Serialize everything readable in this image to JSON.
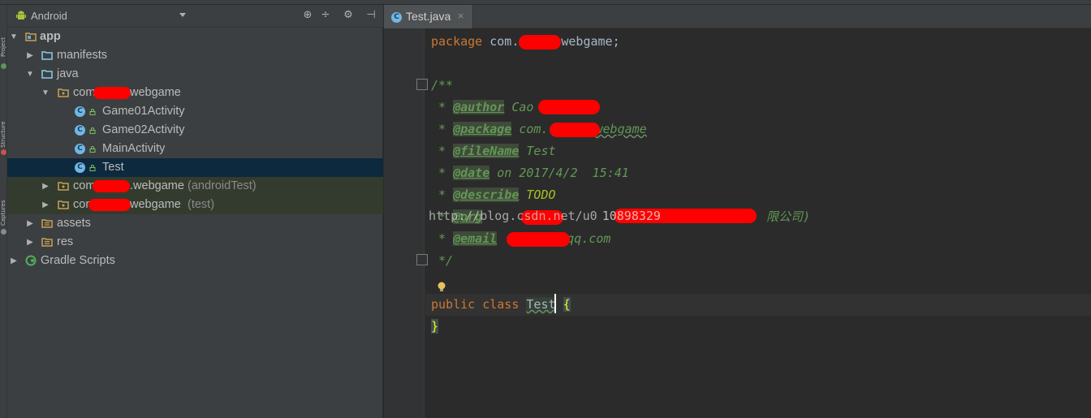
{
  "toolstrip": {
    "labels": [
      "Project",
      "Structure",
      "Captures"
    ],
    "dot_colors": [
      "#57965c",
      "#c75450",
      "#8a8a8a"
    ]
  },
  "project_panel": {
    "view_selector": "Android",
    "header_icons": [
      "target-icon",
      "collapse-icon",
      "gear-icon",
      "pin-icon"
    ],
    "tree": [
      {
        "label": "app",
        "icon": "module-folder-icon",
        "expanded": true
      },
      {
        "label": "manifests",
        "icon": "folder-icon",
        "expanded": false
      },
      {
        "label": "java",
        "icon": "folder-icon",
        "expanded": true
      },
      {
        "prefix": "com",
        "suffix": "webgame",
        "icon": "package-icon",
        "expanded": true
      },
      {
        "label": "Game01Activity",
        "icon": "class-icon"
      },
      {
        "label": "Game02Activity",
        "icon": "class-icon"
      },
      {
        "label": "MainActivity",
        "icon": "class-icon"
      },
      {
        "label": "Test",
        "icon": "class-icon",
        "selected": true
      },
      {
        "prefix": "com",
        "suffix": ".webgame",
        "note": "(androidTest)",
        "icon": "package-icon",
        "expanded": false
      },
      {
        "prefix": "con",
        "suffix": "webgame",
        "note": "(test)",
        "icon": "package-icon",
        "expanded": false
      },
      {
        "label": "assets",
        "icon": "resource-folder-icon",
        "expanded": false
      },
      {
        "label": "res",
        "icon": "resource-folder-icon",
        "expanded": false
      },
      {
        "label": "Gradle Scripts",
        "icon": "gradle-icon",
        "expanded": false
      }
    ]
  },
  "editor": {
    "tab": {
      "label": "Test.java",
      "close": "×"
    },
    "code": {
      "l1_kw": "package",
      "l1_a": " com.",
      "l1_b": "webgame;",
      "l3": "/**",
      "l4_star": " * ",
      "l4_tag": "@author",
      "l4_val": " Cao",
      "l5_tag": "@package",
      "l5_val": " com.",
      "l5_val2": "webgame",
      "l6_tag": "@fileName",
      "l6_val": " Test",
      "l7_tag": "@date",
      "l7_val": " on 2017/4/2  15:41",
      "l8_tag": "@describe",
      "l8_val": " TODO",
      "l9_tag": "@org",
      "l9_val": " ",
      "l9_tail": "限公司)",
      "l10_tag": "@email",
      "l10_val": "qq.com",
      "l11": " */",
      "l13_kw": "public class",
      "l13_name": "Test",
      "l13_brace": "{",
      "l14_brace": "}"
    },
    "watermark_a": "http://blog.csdn.net/u0",
    "watermark_b": "10898329"
  },
  "colors": {
    "selection": "#0d293e",
    "redaction": "#ff0000",
    "keyword": "#cc7832",
    "doc_comment": "#629755"
  }
}
